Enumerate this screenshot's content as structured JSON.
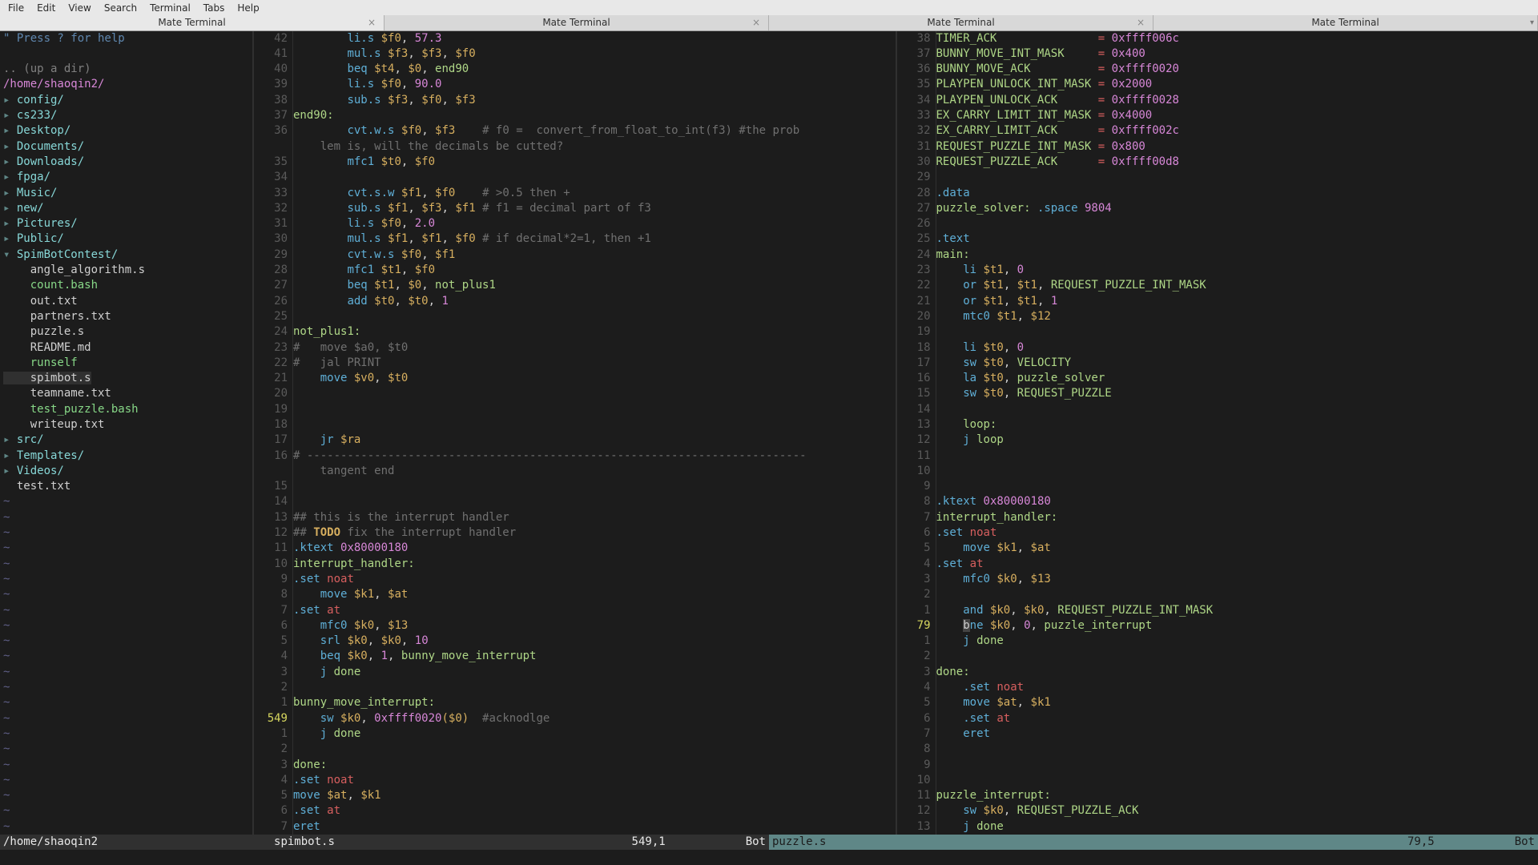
{
  "menu": [
    "File",
    "Edit",
    "View",
    "Search",
    "Terminal",
    "Tabs",
    "Help"
  ],
  "tabs": [
    {
      "label": "Mate Terminal",
      "active": true
    },
    {
      "label": "Mate Terminal",
      "active": false
    },
    {
      "label": "Mate Terminal",
      "active": false
    },
    {
      "label": "Mate Terminal",
      "active": false
    }
  ],
  "tree": {
    "help_line": "\" Press ? for help",
    "updir": ".. (up a dir)",
    "path": "/home/shaoqin2/",
    "dirs_top": [
      "config/",
      "cs233/",
      "Desktop/",
      "Documents/",
      "Downloads/",
      "fpga/",
      "Music/",
      "new/",
      "Pictures/",
      "Public/"
    ],
    "spim": {
      "name": "SpimBotContest/",
      "files": [
        "angle_algorithm.s",
        "count.bash",
        "out.txt",
        "partners.txt",
        "puzzle.s",
        "README.md",
        "runself",
        "spimbot.s",
        "teamname.txt",
        "test_puzzle.bash",
        "writeup.txt"
      ]
    },
    "dirs_bot": [
      "src/",
      "Templates/",
      "Videos/"
    ],
    "loose_files": [
      "test.txt"
    ]
  },
  "left_code": [
    {
      "n": "42",
      "t": "        li.s $f0, 57.3",
      "hl": [
        "li.s",
        "$f0",
        "57.3"
      ]
    },
    {
      "n": "41",
      "t": "        mul.s $f3, $f3, $f0",
      "hl": [
        "mul.s",
        "$f3",
        "$f3",
        "$f0"
      ]
    },
    {
      "n": "40",
      "t": "        beq $t4, $0, end90",
      "hl": [
        "beq",
        "$t4",
        "$0",
        "end90"
      ]
    },
    {
      "n": "39",
      "t": "        li.s $f0, 90.0",
      "hl": [
        "li.s",
        "$f0",
        "90.0"
      ]
    },
    {
      "n": "38",
      "t": "        sub.s $f3, $f0, $f3",
      "hl": [
        "sub.s",
        "$f3",
        "$f0",
        "$f3"
      ]
    },
    {
      "n": "37",
      "t": "end90:",
      "label": true
    },
    {
      "n": "36",
      "t": "        cvt.w.s $f0, $f3        # f0 =  convert_from_float_to_int(f3) #the prob",
      "hl": [
        "cvt.w.s",
        "$f0",
        "$f3"
      ],
      "comment": "# f0 =  convert_from_float_to_int(f3) #the prob"
    },
    {
      "n": "",
      "t": "    lem is, will the decimals be cutted?",
      "allcomment": true
    },
    {
      "n": "35",
      "t": "        mfc1 $t0, $f0",
      "hl": [
        "mfc1",
        "$t0",
        "$f0"
      ]
    },
    {
      "n": "34",
      "t": ""
    },
    {
      "n": "33",
      "t": "        cvt.s.w $f1, $f0        # >0.5 then +",
      "hl": [
        "cvt.s.w",
        "$f1",
        "$f0"
      ],
      "comment": "# >0.5 then +"
    },
    {
      "n": "32",
      "t": "        sub.s $f1, $f3, $f1     # f1 = decimal part of f3",
      "hl": [
        "sub.s",
        "$f1",
        "$f3",
        "$f1"
      ],
      "comment": "# f1 = decimal part of f3"
    },
    {
      "n": "31",
      "t": "        li.s $f0, 2.0",
      "hl": [
        "li.s",
        "$f0",
        "2.0"
      ]
    },
    {
      "n": "30",
      "t": "        mul.s $f1, $f1, $f0     # if decimal*2=1, then +1",
      "hl": [
        "mul.s",
        "$f1",
        "$f1",
        "$f0"
      ],
      "comment": "# if decimal*2=1, then +1"
    },
    {
      "n": "29",
      "t": "        cvt.w.s $f0, $f1",
      "hl": [
        "cvt.w.s",
        "$f0",
        "$f1"
      ]
    },
    {
      "n": "28",
      "t": "        mfc1 $t1, $f0",
      "hl": [
        "mfc1",
        "$t1",
        "$f0"
      ]
    },
    {
      "n": "27",
      "t": "        beq $t1, $0, not_plus1",
      "hl": [
        "beq",
        "$t1",
        "$0",
        "not_plus1"
      ]
    },
    {
      "n": "26",
      "t": "        add $t0, $t0, 1",
      "hl": [
        "add",
        "$t0",
        "$t0",
        "1"
      ]
    },
    {
      "n": "25",
      "t": ""
    },
    {
      "n": "24",
      "t": "not_plus1:",
      "label": true
    },
    {
      "n": "23",
      "t": "#   move $a0, $t0",
      "allcomment": true
    },
    {
      "n": "22",
      "t": "#   jal PRINT",
      "allcomment": true
    },
    {
      "n": "21",
      "t": "    move $v0, $t0",
      "hl": [
        "move",
        "$v0",
        "$t0"
      ]
    },
    {
      "n": "20",
      "t": ""
    },
    {
      "n": "19",
      "t": ""
    },
    {
      "n": "18",
      "t": ""
    },
    {
      "n": "17",
      "t": "    jr $ra",
      "hl": [
        "jr",
        "$ra"
      ]
    },
    {
      "n": "16",
      "t": "# --------------------------------------------------------------------------",
      "allcomment": true
    },
    {
      "n": "",
      "t": "    tangent end",
      "allcomment": true
    },
    {
      "n": "15",
      "t": ""
    },
    {
      "n": "14",
      "t": ""
    },
    {
      "n": "13",
      "t": "## this is the interrupt handler",
      "allcomment": true
    },
    {
      "n": "12",
      "t": "## TODO fix the interrupt handler",
      "todo": true
    },
    {
      "n": "11",
      "t": ".ktext 0x80000180",
      "dir": ".ktext",
      "num": "0x80000180"
    },
    {
      "n": "10",
      "t": "interrupt_handler:",
      "label": true
    },
    {
      "n": "9",
      "t": ".set noat",
      "dir": ".set",
      "kw": "noat"
    },
    {
      "n": "8",
      "t": "    move $k1, $at",
      "hl": [
        "move",
        "$k1",
        "$at"
      ]
    },
    {
      "n": "7",
      "t": ".set at",
      "dir": ".set",
      "kw": "at"
    },
    {
      "n": "6",
      "t": "    mfc0 $k0, $13",
      "hl": [
        "mfc0",
        "$k0",
        "$13"
      ]
    },
    {
      "n": "5",
      "t": "    srl  $k0, $k0, 10",
      "hl": [
        "srl",
        "$k0",
        "$k0",
        "10"
      ]
    },
    {
      "n": "4",
      "t": "    beq $k0, 1, bunny_move_interrupt",
      "hl": [
        "beq",
        "$k0",
        "1",
        "bunny_move_interrupt"
      ]
    },
    {
      "n": "3",
      "t": "    j done",
      "hl": [
        "j",
        "done"
      ]
    },
    {
      "n": "2",
      "t": ""
    },
    {
      "n": "1",
      "t": "bunny_move_interrupt:",
      "label": true
    },
    {
      "n": "549",
      "cur": true,
      "t": "    sw $k0, 0xffff0020($0)  #acknodlge",
      "hl": [
        "sw",
        "$k0"
      ],
      "num": "0xffff0020",
      "paren": "($0)",
      "comment": "#acknodlge"
    },
    {
      "n": "1",
      "t": "    j done",
      "hl": [
        "j",
        "done"
      ]
    },
    {
      "n": "2",
      "t": ""
    },
    {
      "n": "3",
      "t": "done:",
      "label": true
    },
    {
      "n": "4",
      "t": ".set noat",
      "dir": ".set",
      "kw": "noat"
    },
    {
      "n": "5",
      "t": "move $at, $k1",
      "hl": [
        "move",
        "$at",
        "$k1"
      ]
    },
    {
      "n": "6",
      "t": ".set at",
      "dir": ".set",
      "kw": "at"
    },
    {
      "n": "7",
      "t": "eret",
      "hl": [
        "eret"
      ]
    }
  ],
  "right_code": [
    {
      "n": "38",
      "t": "TIMER_ACK               = 0xffff006c",
      "const": "TIMER_ACK",
      "val": "0xffff006c"
    },
    {
      "n": "37",
      "t": "BUNNY_MOVE_INT_MASK     = 0x400",
      "const": "BUNNY_MOVE_INT_MASK",
      "val": "0x400"
    },
    {
      "n": "36",
      "t": "BUNNY_MOVE_ACK          = 0xffff0020",
      "const": "BUNNY_MOVE_ACK",
      "val": "0xffff0020"
    },
    {
      "n": "35",
      "t": "PLAYPEN_UNLOCK_INT_MASK = 0x2000",
      "const": "PLAYPEN_UNLOCK_INT_MASK",
      "val": "0x2000"
    },
    {
      "n": "34",
      "t": "PLAYPEN_UNLOCK_ACK      = 0xffff0028",
      "const": "PLAYPEN_UNLOCK_ACK",
      "val": "0xffff0028"
    },
    {
      "n": "33",
      "t": "EX_CARRY_LIMIT_INT_MASK = 0x4000",
      "const": "EX_CARRY_LIMIT_INT_MASK",
      "val": "0x4000"
    },
    {
      "n": "32",
      "t": "EX_CARRY_LIMIT_ACK      = 0xffff002c",
      "const": "EX_CARRY_LIMIT_ACK",
      "val": "0xffff002c"
    },
    {
      "n": "31",
      "t": "REQUEST_PUZZLE_INT_MASK = 0x800",
      "const": "REQUEST_PUZZLE_INT_MASK",
      "val": "0x800"
    },
    {
      "n": "30",
      "t": "REQUEST_PUZZLE_ACK      = 0xffff00d8",
      "const": "REQUEST_PUZZLE_ACK",
      "val": "0xffff00d8"
    },
    {
      "n": "29",
      "t": ""
    },
    {
      "n": "28",
      "t": ".data",
      "dironly": ".data"
    },
    {
      "n": "27",
      "t": "puzzle_solver: .space 9804",
      "label": "puzzle_solver:",
      "dir": ".space",
      "num": "9804"
    },
    {
      "n": "26",
      "t": ""
    },
    {
      "n": "25",
      "t": ".text",
      "dironly": ".text"
    },
    {
      "n": "24",
      "t": "main:",
      "labelonly": true
    },
    {
      "n": "23",
      "t": "    li $t1, 0",
      "hl": [
        "li",
        "$t1",
        "0"
      ]
    },
    {
      "n": "22",
      "t": "    or $t1, $t1, REQUEST_PUZZLE_INT_MASK",
      "hl": [
        "or",
        "$t1",
        "$t1",
        "REQUEST_PUZZLE_INT_MASK"
      ]
    },
    {
      "n": "21",
      "t": "    or $t1, $t1, 1",
      "hl": [
        "or",
        "$t1",
        "$t1",
        "1"
      ]
    },
    {
      "n": "20",
      "t": "    mtc0 $t1, $12",
      "hl": [
        "mtc0",
        "$t1",
        "$12"
      ]
    },
    {
      "n": "19",
      "t": ""
    },
    {
      "n": "18",
      "t": "    li $t0, 0",
      "hl": [
        "li",
        "$t0",
        "0"
      ]
    },
    {
      "n": "17",
      "t": "    sw $t0, VELOCITY",
      "hl": [
        "sw",
        "$t0",
        "VELOCITY"
      ]
    },
    {
      "n": "16",
      "t": "    la $t0, puzzle_solver",
      "hl": [
        "la",
        "$t0",
        "puzzle_solver"
      ]
    },
    {
      "n": "15",
      "t": "    sw $t0, REQUEST_PUZZLE",
      "hl": [
        "sw",
        "$t0",
        "REQUEST_PUZZLE"
      ]
    },
    {
      "n": "14",
      "t": ""
    },
    {
      "n": "13",
      "t": "    loop:",
      "labelonly": true,
      "indent": "    "
    },
    {
      "n": "12",
      "t": "    j loop",
      "hl": [
        "j",
        "loop"
      ]
    },
    {
      "n": "11",
      "t": ""
    },
    {
      "n": "10",
      "t": ""
    },
    {
      "n": "9",
      "t": ""
    },
    {
      "n": "8",
      "t": ".ktext 0x80000180",
      "dir": ".ktext",
      "num": "0x80000180"
    },
    {
      "n": "7",
      "t": "interrupt_handler:",
      "labelonly": true
    },
    {
      "n": "6",
      "t": ".set noat",
      "dir": ".set",
      "kw": "noat"
    },
    {
      "n": "5",
      "t": "    move $k1, $at",
      "hl": [
        "move",
        "$k1",
        "$at"
      ]
    },
    {
      "n": "4",
      "t": ".set at",
      "dir": ".set",
      "kw": "at"
    },
    {
      "n": "3",
      "t": "    mfc0 $k0, $13",
      "hl": [
        "mfc0",
        "$k0",
        "$13"
      ]
    },
    {
      "n": "2",
      "t": ""
    },
    {
      "n": "1",
      "t": "    and $k0, $k0, REQUEST_PUZZLE_INT_MASK",
      "hl": [
        "and",
        "$k0",
        "$k0",
        "REQUEST_PUZZLE_INT_MASK"
      ]
    },
    {
      "n": "79",
      "cur": true,
      "t": "    bne $k0, 0, puzzle_interrupt",
      "hl": [
        "bne",
        "$k0",
        "0",
        "puzzle_interrupt"
      ],
      "cursor": 4
    },
    {
      "n": "1",
      "t": "    j done",
      "hl": [
        "j",
        "done"
      ]
    },
    {
      "n": "2",
      "t": ""
    },
    {
      "n": "3",
      "t": "done:",
      "labelonly": true
    },
    {
      "n": "4",
      "t": "    .set noat",
      "dir": ".set",
      "kw": "noat",
      "indent": "    "
    },
    {
      "n": "5",
      "t": "    move $at, $k1",
      "hl": [
        "move",
        "$at",
        "$k1"
      ]
    },
    {
      "n": "6",
      "t": "    .set at",
      "dir": ".set",
      "kw": "at",
      "indent": "    "
    },
    {
      "n": "7",
      "t": "    eret",
      "hl": [
        "eret"
      ],
      "indent": "    "
    },
    {
      "n": "8",
      "t": ""
    },
    {
      "n": "9",
      "t": ""
    },
    {
      "n": "10",
      "t": ""
    },
    {
      "n": "11",
      "t": "puzzle_interrupt:",
      "labelonly": true
    },
    {
      "n": "12",
      "t": "    sw $k0, REQUEST_PUZZLE_ACK",
      "hl": [
        "sw",
        "$k0",
        "REQUEST_PUZZLE_ACK"
      ]
    },
    {
      "n": "13",
      "t": "    j done",
      "hl": [
        "j",
        "done"
      ]
    }
  ],
  "status": {
    "left_path": "/home/shaoqin2",
    "left_file": "spimbot.s",
    "left_pos": "549,1",
    "left_pct": "Bot",
    "right_file": "puzzle.s",
    "right_pos": "79,5",
    "right_pct": "Bot"
  }
}
